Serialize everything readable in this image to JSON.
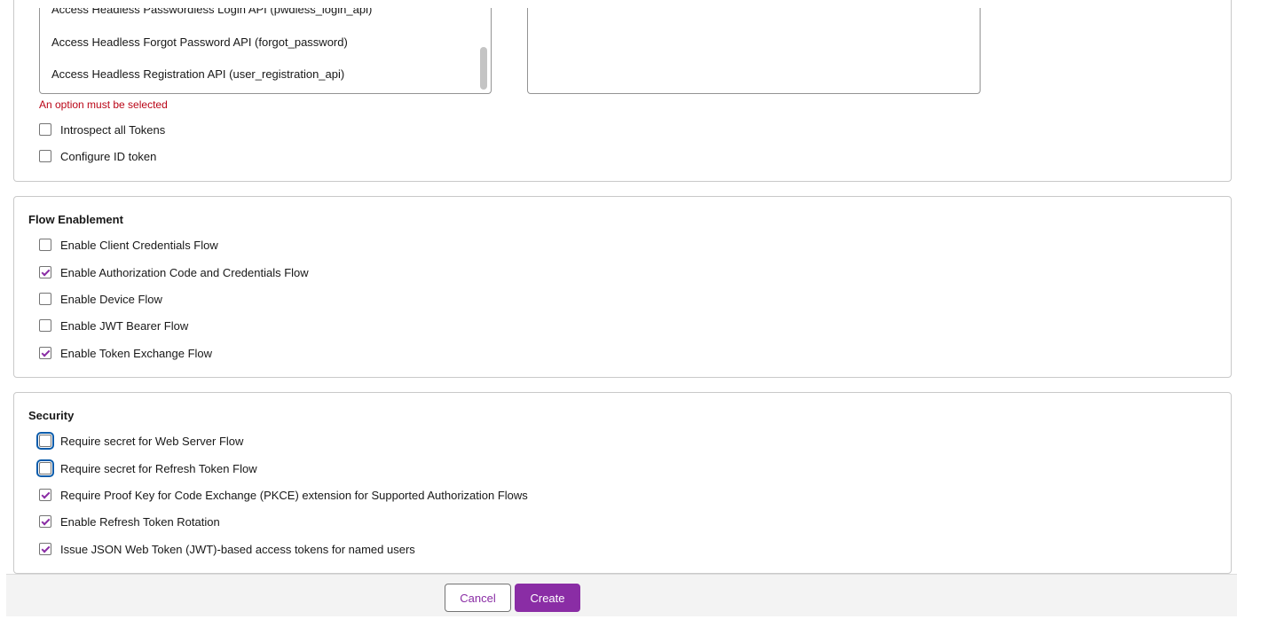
{
  "scopes": {
    "selected_options": [
      "Access Headless Passwordless Login API (pwdless_login_api)",
      "Access Headless Forgot Password API (forgot_password)",
      "Access Headless Registration API (user_registration_api)"
    ],
    "error": "An option must be selected",
    "checkboxes": [
      {
        "label": "Introspect all Tokens",
        "checked": false
      },
      {
        "label": "Configure ID token",
        "checked": false
      }
    ]
  },
  "flow": {
    "title": "Flow Enablement",
    "checkboxes": [
      {
        "label": "Enable Client Credentials Flow",
        "checked": false
      },
      {
        "label": "Enable Authorization Code and Credentials Flow",
        "checked": true
      },
      {
        "label": "Enable Device Flow",
        "checked": false
      },
      {
        "label": "Enable JWT Bearer Flow",
        "checked": false
      },
      {
        "label": "Enable Token Exchange Flow",
        "checked": true
      }
    ]
  },
  "security": {
    "title": "Security",
    "checkboxes": [
      {
        "label": "Require secret for Web Server Flow",
        "checked": false,
        "focused": true
      },
      {
        "label": "Require secret for Refresh Token Flow",
        "checked": false,
        "focused": true
      },
      {
        "label": "Require Proof Key for Code Exchange (PKCE) extension for Supported Authorization Flows",
        "checked": true
      },
      {
        "label": "Enable Refresh Token Rotation",
        "checked": true
      },
      {
        "label": "Issue JSON Web Token (JWT)-based access tokens for named users",
        "checked": true
      }
    ]
  },
  "footer": {
    "cancel_label": "Cancel",
    "create_label": "Create"
  },
  "colors": {
    "accent": "#8a2da5",
    "error": "#ba0517",
    "focus": "#0b5cab"
  }
}
